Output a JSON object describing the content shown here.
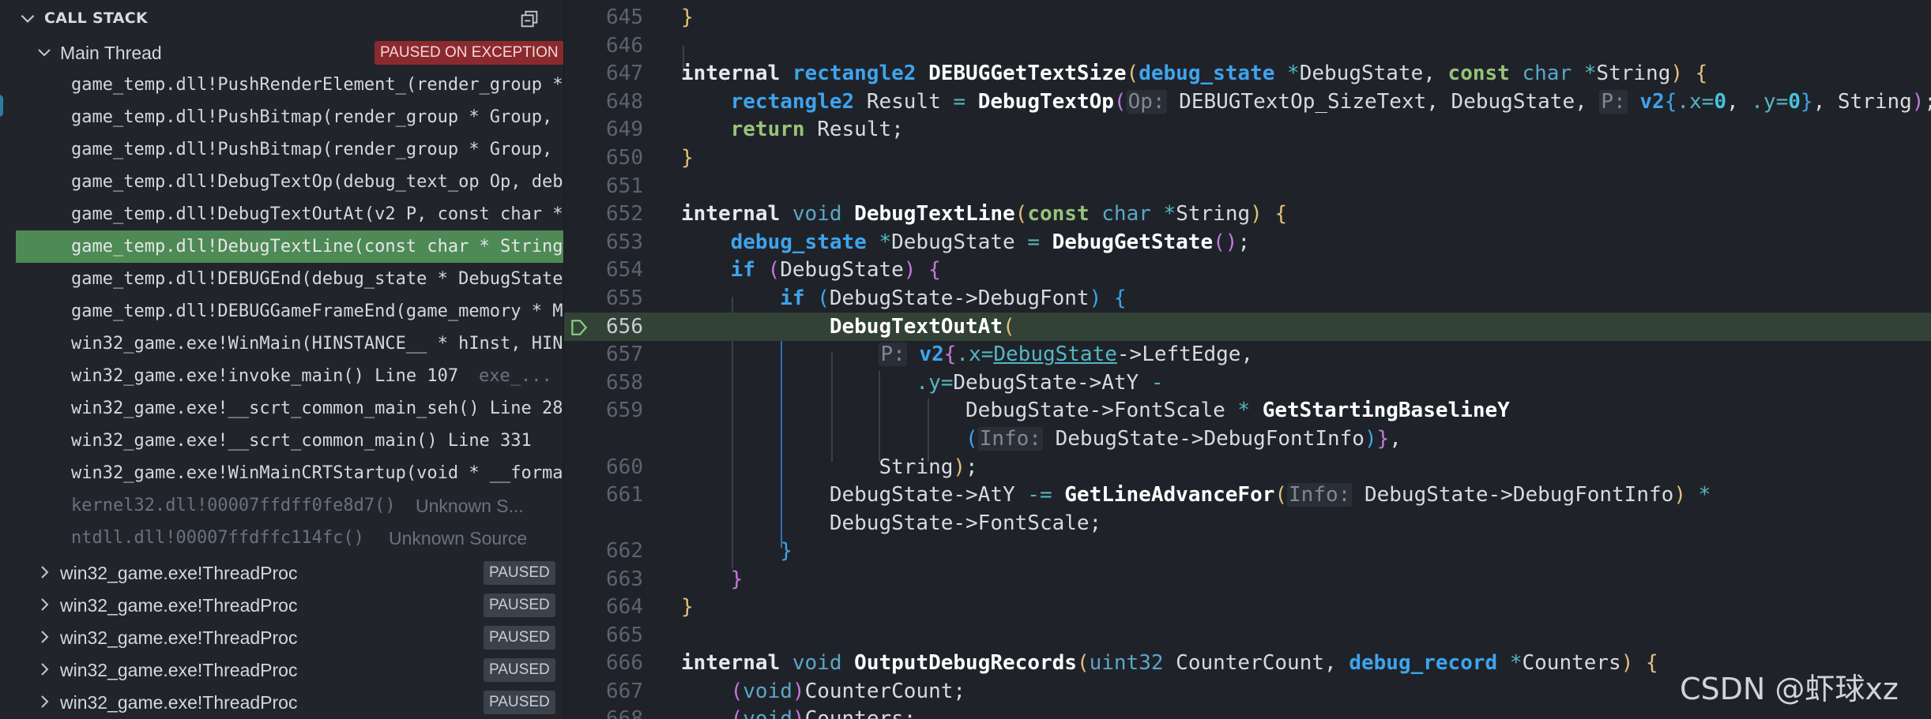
{
  "call_stack": {
    "title": "CALL STACK",
    "main_thread": {
      "label": "Main Thread",
      "status": "PAUSED ON EXCEPTION"
    },
    "frames": [
      {
        "name": "game_temp.dll!PushRenderElement_(render_group *"
      },
      {
        "name": "game_temp.dll!PushBitmap(render_group * Group,"
      },
      {
        "name": "game_temp.dll!PushBitmap(render_group * Group,"
      },
      {
        "name": "game_temp.dll!DebugTextOp(debug_text_op Op, deb"
      },
      {
        "name": "game_temp.dll!DebugTextOutAt(v2 P, const char *"
      },
      {
        "name": "game_temp.dll!DebugTextLine(const char * String"
      },
      {
        "name": "game_temp.dll!DEBUGEnd(debug_state * DebugState"
      },
      {
        "name": "game_temp.dll!DEBUGGameFrameEnd(game_memory * M"
      },
      {
        "name": "win32_game.exe!WinMain(HINSTANCE__ * hInst, HIN"
      },
      {
        "name": "win32_game.exe!invoke_main() Line 107",
        "source": "exe_..."
      },
      {
        "name": "win32_game.exe!__scrt_common_main_seh() Line 28"
      },
      {
        "name": "win32_game.exe!__scrt_common_main() Line 331"
      },
      {
        "name": "win32_game.exe!WinMainCRTStartup(void * __forma"
      },
      {
        "name": "kernel32.dll!00007ffdff0fe8d7()",
        "source": "Unknown S..."
      },
      {
        "name": "ntdll.dll!00007ffdffc114fc()",
        "source": "Unknown Source"
      }
    ],
    "threads": [
      {
        "label": "win32_game.exe!ThreadProc",
        "status": "PAUSED"
      },
      {
        "label": "win32_game.exe!ThreadProc",
        "status": "PAUSED"
      },
      {
        "label": "win32_game.exe!ThreadProc",
        "status": "PAUSED"
      },
      {
        "label": "win32_game.exe!ThreadProc",
        "status": "PAUSED"
      },
      {
        "label": "win32_game.exe!ThreadProc",
        "status": "PAUSED"
      }
    ]
  },
  "editor": {
    "current_line": "656",
    "lines": [
      {
        "n": "645"
      },
      {
        "n": "646"
      },
      {
        "n": "647"
      },
      {
        "n": "648"
      },
      {
        "n": "649"
      },
      {
        "n": "650"
      },
      {
        "n": "651"
      },
      {
        "n": "652"
      },
      {
        "n": "653"
      },
      {
        "n": "654"
      },
      {
        "n": "655"
      },
      {
        "n": "656"
      },
      {
        "n": "657"
      },
      {
        "n": "658"
      },
      {
        "n": "659"
      },
      {
        "n": ""
      },
      {
        "n": "660"
      },
      {
        "n": "661"
      },
      {
        "n": ""
      },
      {
        "n": "662"
      },
      {
        "n": "663"
      },
      {
        "n": "664"
      },
      {
        "n": "665"
      },
      {
        "n": "666"
      },
      {
        "n": "667"
      },
      {
        "n": "668"
      }
    ]
  },
  "watermark": "CSDN @虾球xz",
  "colors": {
    "selected_frame": "#4d8a55",
    "exception_badge": "#8b2a2e",
    "current_line": "#334236"
  }
}
